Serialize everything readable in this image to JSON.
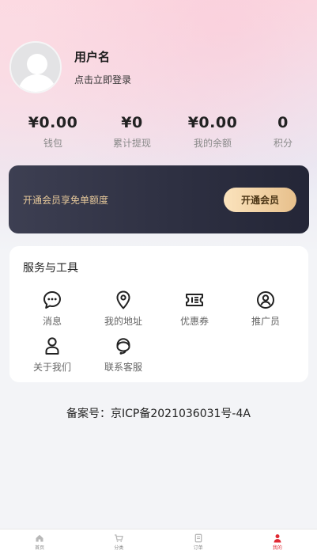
{
  "profile": {
    "username": "用户名",
    "login_hint": "点击立即登录"
  },
  "stats": [
    {
      "value": "¥0.00",
      "label": "钱包"
    },
    {
      "value": "¥0",
      "label": "累计提现"
    },
    {
      "value": "¥0.00",
      "label": "我的余额"
    },
    {
      "value": "0",
      "label": "积分"
    }
  ],
  "vip": {
    "text": "开通会员享免单额度",
    "button": "开通会员",
    "colors": {
      "banner": "#2e3042",
      "text": "#e6c89a",
      "button": "#f3d3a4"
    }
  },
  "services": {
    "title": "服务与工具",
    "items": [
      {
        "label": "消息",
        "icon": "message-icon"
      },
      {
        "label": "我的地址",
        "icon": "location-pin-icon"
      },
      {
        "label": "优惠券",
        "icon": "coupon-icon"
      },
      {
        "label": "推广员",
        "icon": "promoter-icon"
      },
      {
        "label": "关于我们",
        "icon": "person-icon"
      },
      {
        "label": "联系客服",
        "icon": "headset-icon"
      }
    ]
  },
  "icp": "备案号：京ICP备2021036031号-4A",
  "tabbar": {
    "items": [
      {
        "label": "首页",
        "icon": "home-icon"
      },
      {
        "label": "分类",
        "icon": "cart-icon"
      },
      {
        "label": "订单",
        "icon": "order-icon"
      },
      {
        "label": "我的",
        "icon": "user-icon",
        "active": true
      }
    ],
    "active_color": "#e02a34"
  }
}
